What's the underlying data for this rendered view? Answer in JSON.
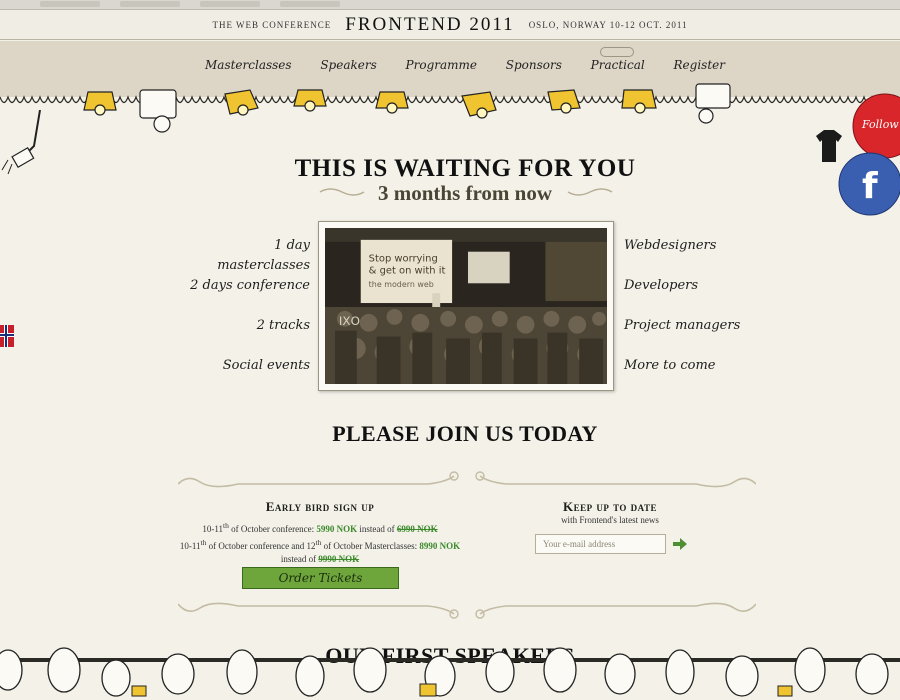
{
  "header": {
    "left_tagline": "The Web Conference",
    "brand": "FRONTEND 2011",
    "right_tagline": "Oslo, Norway 10-12 Oct. 2011"
  },
  "nav": {
    "items": [
      {
        "label": "Masterclasses"
      },
      {
        "label": "Speakers"
      },
      {
        "label": "Programme"
      },
      {
        "label": "Sponsors"
      },
      {
        "label": "Practical"
      },
      {
        "label": "Register"
      }
    ]
  },
  "hero": {
    "title": "THIS IS WAITING FOR YOU",
    "subtitle": "3 months from now"
  },
  "features_left": [
    "1 day masterclasses",
    "2 days conference",
    "2 tracks",
    "Social events"
  ],
  "features_right": [
    "Webdesigners",
    "Developers",
    "Project managers",
    "More to come"
  ],
  "photo": {
    "slide_text_line1": "Stop worrying",
    "slide_text_line2": "& get on with it",
    "slide_text_line3": "the modern web"
  },
  "join": {
    "title": "PLEASE JOIN US TODAY"
  },
  "early_bird": {
    "heading": "Early bird sign up",
    "conf_prefix": "10-11",
    "conf_sup": "th",
    "conf_text": " of October conference: ",
    "conf_price": "5990 NOK",
    "conf_instead": " instead of ",
    "conf_old": "6990 NOK",
    "combo_prefix": "10-11",
    "combo_sup1": "th",
    "combo_text1": " of October conference and 12",
    "combo_sup2": "th",
    "combo_text2": " of October Masterclasses: ",
    "combo_price": "8990 NOK",
    "combo_instead": "instead of ",
    "combo_old": "9990 NOK",
    "button_label": "Order Tickets"
  },
  "newsletter": {
    "heading": "Keep up to date",
    "subtext": "with Frontend's latest news",
    "placeholder": "Your e-mail address"
  },
  "speakers": {
    "title": "OUR FIRST SPEAKERS"
  },
  "social": {
    "follow_label": "Follow",
    "facebook_letter": "f"
  },
  "colors": {
    "background": "#f3f1e8",
    "nav_band": "#ddd6c6",
    "accent_green": "#6fa63c",
    "price_green": "#3d8a2d",
    "social_red": "#d9262a",
    "facebook_blue": "#3b5fb0"
  }
}
